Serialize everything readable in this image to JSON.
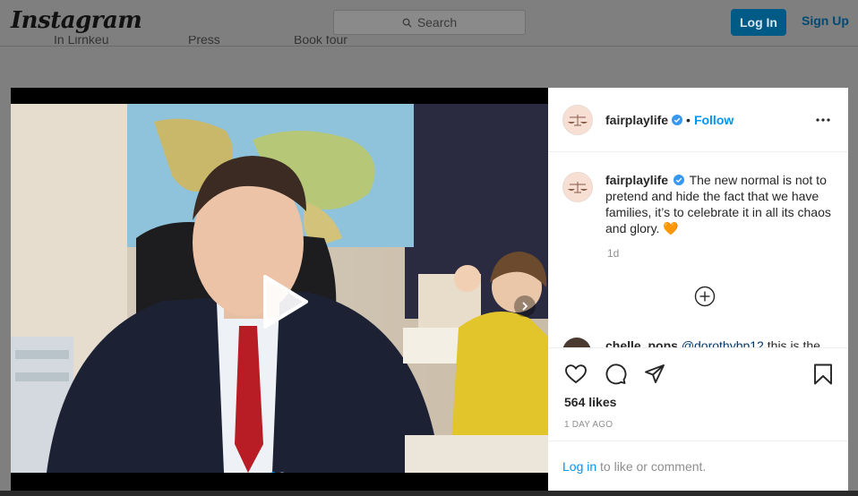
{
  "header": {
    "logo": "Instagram",
    "search_placeholder": "Search",
    "login_label": "Log In",
    "signup_label": "Sign Up"
  },
  "background_nav": [
    "In Lirnkeu",
    "Press",
    "Book four"
  ],
  "post": {
    "author": "fairplaylife",
    "follow_label": "Follow",
    "bullet": "•",
    "caption": "The new normal is not to pretend and hide the fact that we have families, it’s to celebrate it in all its chaos and glory. 🧡",
    "caption_age": "1d",
    "next_comment": {
      "username": "chelle_pops",
      "mention": "@dorothybp12",
      "text": "this is the"
    },
    "likes": "564 likes",
    "date": "1 DAY AGO",
    "footer": {
      "login_link": "Log in",
      "suffix": " to like or comment."
    },
    "media": {
      "slides": 2,
      "active_slide": 1
    }
  },
  "colors": {
    "accent": "#0095f6",
    "overlay": "#7f7f7f",
    "verified": "#3897f0"
  },
  "icons": [
    "search-icon",
    "verified-icon",
    "more-icon",
    "play-icon",
    "chevron-right-icon",
    "add-circle-icon",
    "heart-icon",
    "comment-icon",
    "share-icon",
    "bookmark-icon"
  ]
}
